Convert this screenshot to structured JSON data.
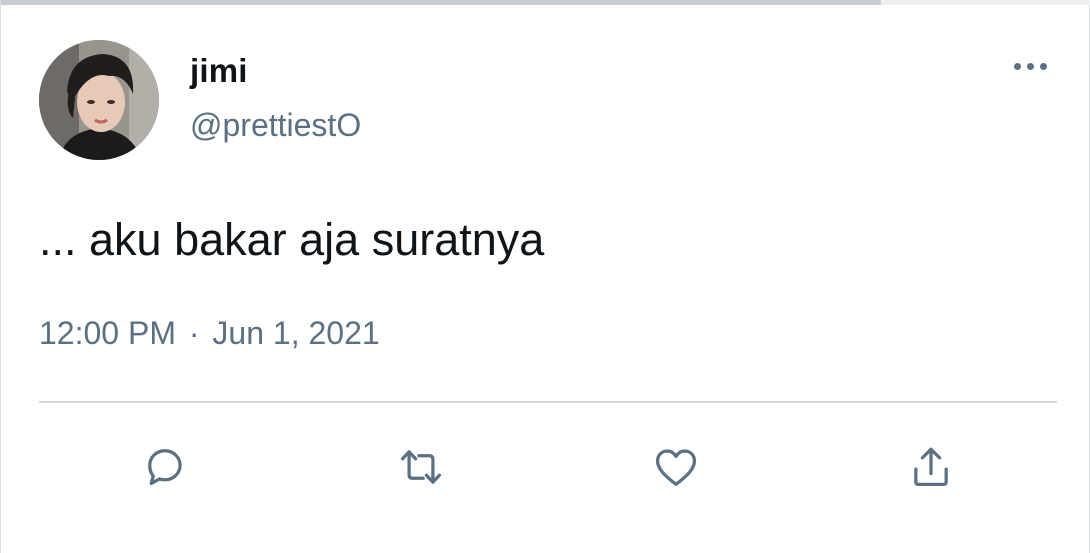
{
  "tweet": {
    "author": {
      "display_name": "jimi",
      "handle": "@prettiestO",
      "avatar_icon": "profile-photo"
    },
    "text": "... aku bakar aja suratnya",
    "time": "12:00 PM",
    "separator": "·",
    "date": "Jun 1, 2021"
  },
  "actions": {
    "reply_icon": "speech-bubble-icon",
    "retweet_icon": "retweet-arrows-icon",
    "like_icon": "heart-icon",
    "share_icon": "upload-arrow-icon",
    "more_icon": "ellipsis-icon"
  },
  "colors": {
    "text_primary": "#0f1419",
    "text_secondary": "#5b7083",
    "divider": "#d6dbe0",
    "icon": "#5b7083"
  }
}
